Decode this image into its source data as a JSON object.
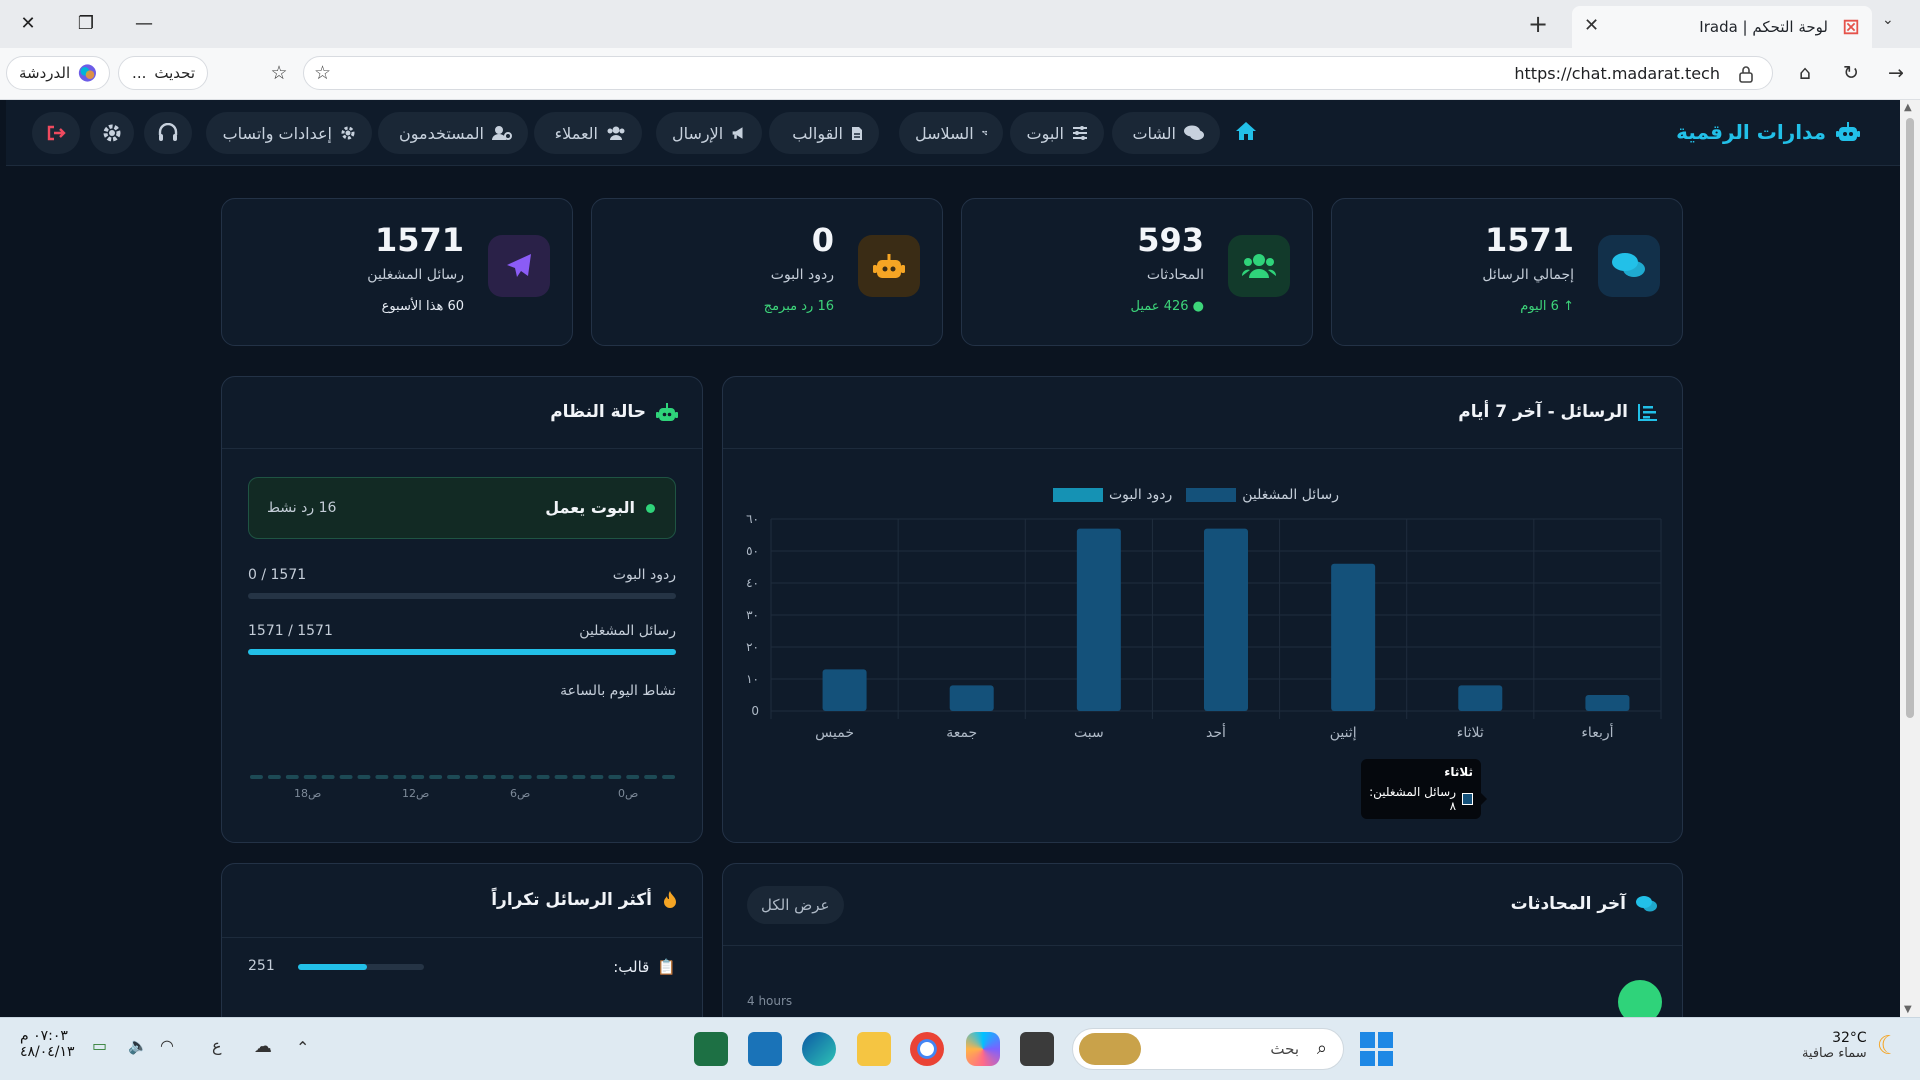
{
  "browser": {
    "tab_title": "لوحة التحكم | Irada",
    "url": "https://chat.madarat.tech",
    "update_label": "تحديث",
    "update_more": "...",
    "chat_label": "الدردشة"
  },
  "app": {
    "brand": "مدارات الرقمية",
    "nav": {
      "chat": "الشات",
      "bot": "البوت",
      "sequences": "السلاسل",
      "templates": "القوالب",
      "sending": "الإرسال",
      "customers": "العملاء",
      "users": "المستخدمون",
      "whatsapp_settings": "إعدادات واتساب"
    }
  },
  "stats": {
    "total_messages": {
      "value": "1571",
      "label": "إجمالي الرسائل",
      "sub": "6 اليوم"
    },
    "conversations": {
      "value": "593",
      "label": "المحادثات",
      "sub": "426 عميل"
    },
    "bot_replies": {
      "value": "0",
      "label": "ردود البوت",
      "sub": "16 رد مبرمج"
    },
    "operator_messages": {
      "value": "1571",
      "label": "رسائل المشغلين",
      "sub": "60 هذا الأسبوع"
    }
  },
  "messages_chart": {
    "title": "الرسائل - آخر 7 أيام",
    "tooltip": {
      "day": "ثلاثاء",
      "text": "رسائل المشغلين: ٨"
    }
  },
  "chart_data": {
    "type": "bar",
    "categories": [
      "أربعاء",
      "ثلاثاء",
      "إثنين",
      "أحد",
      "سبت",
      "جمعة",
      "خميس"
    ],
    "series": [
      {
        "name": "رسائل المشغلين",
        "values": [
          5,
          8,
          46,
          57,
          57,
          8,
          13
        ]
      },
      {
        "name": "ردود البوت",
        "values": [
          0,
          0,
          0,
          0,
          0,
          0,
          0
        ]
      }
    ],
    "y_ticks": [
      "0",
      "١٠",
      "٢٠",
      "٣٠",
      "٤٠",
      "٥٠",
      "٦٠"
    ],
    "ylim": [
      0,
      60
    ],
    "grid": true,
    "legend_position": "top",
    "colors": {
      "operators": "#14517a",
      "bot": "#1592b4"
    }
  },
  "system_status": {
    "title": "حالة النظام",
    "bot_state": "البوت يعمل",
    "active_replies": "16 رد نشط",
    "bot_replies_label": "ردود البوت",
    "bot_replies_value": "0 / 1571",
    "bot_replies_fraction": 0,
    "operator_label": "رسائل المشغلين",
    "operator_value": "1571 / 1571",
    "operator_fraction": 1,
    "hourly_title": "نشاط اليوم بالساعة",
    "hour_labels": [
      "0ص",
      "6ص",
      "12ص",
      "18ص"
    ]
  },
  "recent_conversations": {
    "title": "آخر المحادثات",
    "view_all": "عرض الكل",
    "first_time": "4 hours"
  },
  "top_messages": {
    "title": "أكثر الرسائل تكراراً",
    "items": [
      {
        "label": "قالب:",
        "count": "251",
        "fraction": 0.55
      }
    ]
  },
  "taskbar": {
    "weather_temp": "32°C",
    "weather_desc": "سماء صافية",
    "search_placeholder": "بحث",
    "time": "٠٧:٠٣ م",
    "date": "٤٨/٠٤/١٣",
    "lang": "ع"
  }
}
